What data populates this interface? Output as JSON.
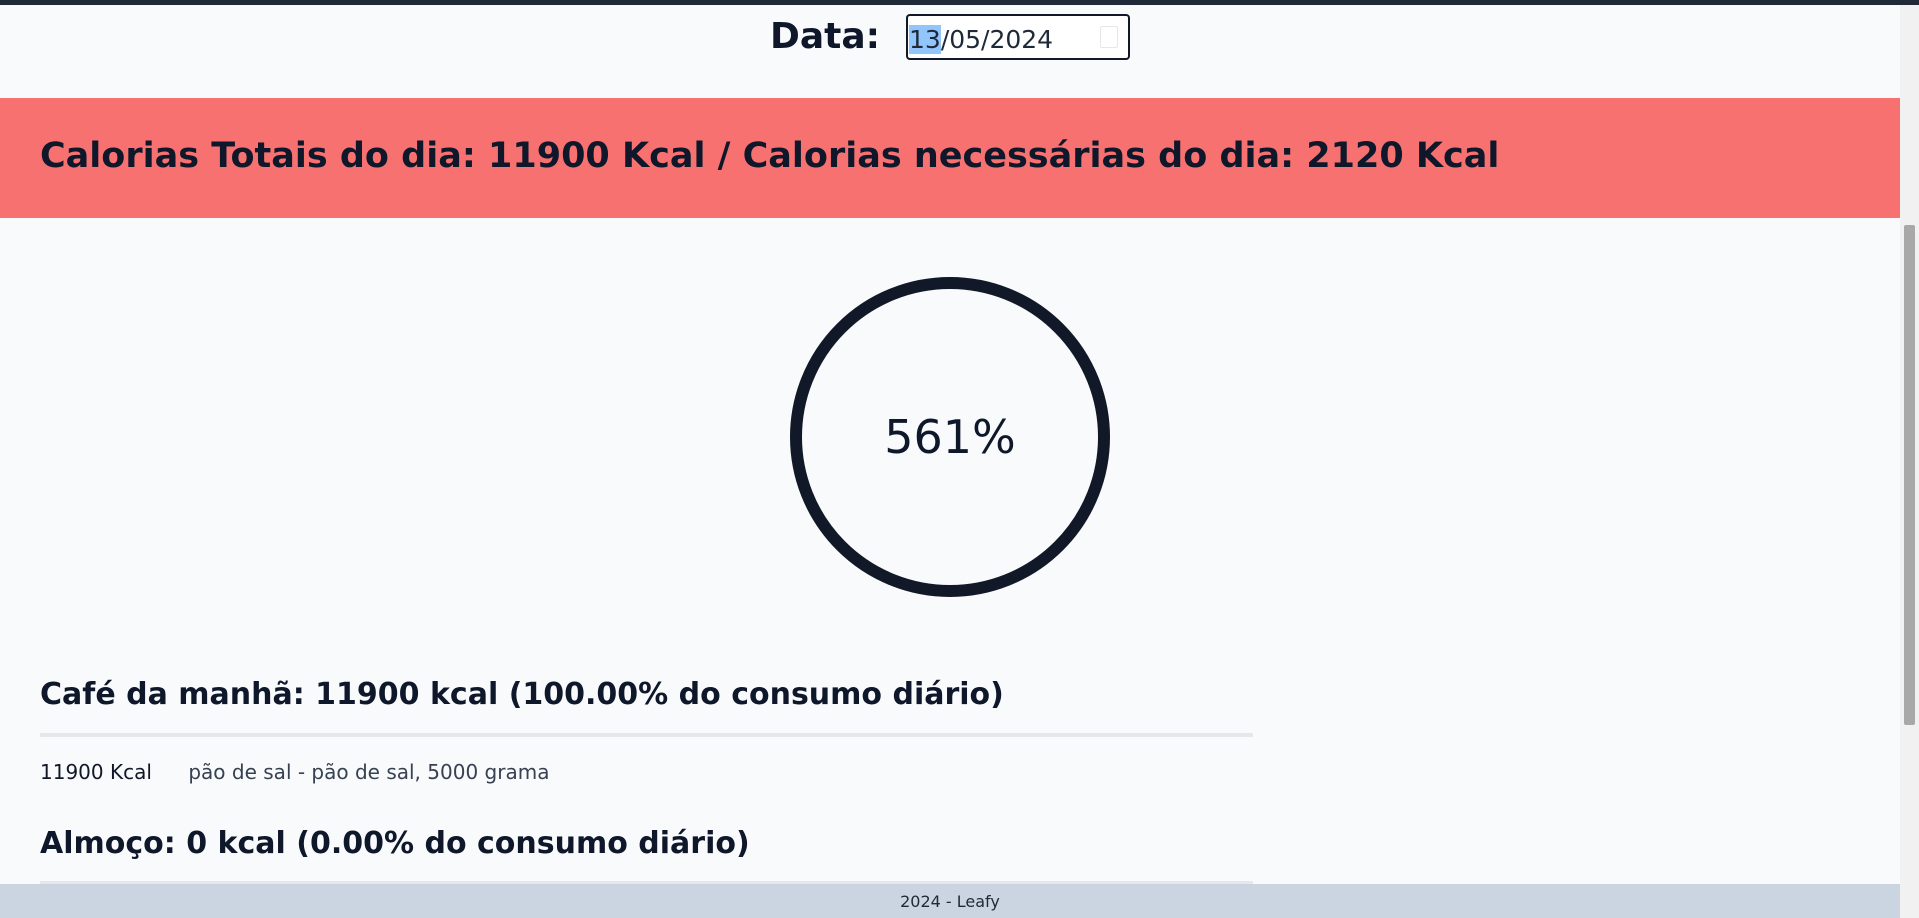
{
  "header": {
    "date_label": "Data:",
    "date_day": "13",
    "date_rest": "/05/2024"
  },
  "banner": {
    "text": "Calorias Totais do dia: 11900 Kcal / Calorias necessárias do dia: 2120 Kcal",
    "color": "#f87171"
  },
  "progress": {
    "percent_text": "561%",
    "percent_value": 561
  },
  "meals": [
    {
      "title": "Café da manhã: 11900 kcal (100.00% do consumo diário)",
      "items": [
        {
          "kcal": "11900 Kcal",
          "description": "pão de sal - pão de sal, 5000 grama"
        }
      ]
    },
    {
      "title": "Almoço: 0 kcal (0.00% do consumo diário)",
      "items": []
    }
  ],
  "footer": {
    "text": "2024 - Leafy"
  }
}
